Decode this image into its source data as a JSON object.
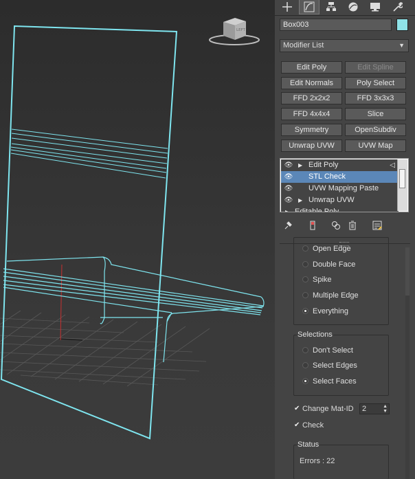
{
  "panel": {
    "tabs": [
      {
        "name": "create-tab",
        "icon": "plus-icon"
      },
      {
        "name": "modify-tab",
        "icon": "modify-curve-icon"
      },
      {
        "name": "hierarchy-tab",
        "icon": "hierarchy-icon"
      },
      {
        "name": "motion-tab",
        "icon": "motion-icon"
      },
      {
        "name": "display-tab",
        "icon": "display-icon"
      },
      {
        "name": "utilities-tab",
        "icon": "wrench-icon"
      }
    ],
    "object_name": "Box003",
    "object_color": "#8fe3e8",
    "modifier_list_label": "Modifier List",
    "modifier_buttons": [
      {
        "label": "Edit Poly",
        "enabled": true
      },
      {
        "label": "Edit Spline",
        "enabled": false
      },
      {
        "label": "Edit Normals",
        "enabled": true
      },
      {
        "label": "Poly Select",
        "enabled": true
      },
      {
        "label": "FFD 2x2x2",
        "enabled": true
      },
      {
        "label": "FFD 3x3x3",
        "enabled": true
      },
      {
        "label": "FFD 4x4x4",
        "enabled": true
      },
      {
        "label": "Slice",
        "enabled": true
      },
      {
        "label": "Symmetry",
        "enabled": true
      },
      {
        "label": "OpenSubdiv",
        "enabled": true
      },
      {
        "label": "Unwrap UVW",
        "enabled": true
      },
      {
        "label": "UVW Map",
        "enabled": true
      }
    ],
    "stack": [
      {
        "label": "Edit Poly",
        "expandable": true,
        "selected": false
      },
      {
        "label": "STL Check",
        "expandable": false,
        "selected": true
      },
      {
        "label": "UVW Mapping Paste",
        "expandable": false,
        "selected": false
      },
      {
        "label": "Unwrap UVW",
        "expandable": true,
        "selected": false
      },
      {
        "label": "Editable Poly",
        "expandable": true,
        "selected": false
      }
    ],
    "check_options": [
      {
        "label": "Open Edge",
        "checked": false
      },
      {
        "label": "Double Face",
        "checked": false
      },
      {
        "label": "Spike",
        "checked": false
      },
      {
        "label": "Multiple Edge",
        "checked": false
      },
      {
        "label": "Everything",
        "checked": true
      }
    ],
    "selections": {
      "title": "Selections",
      "options": [
        {
          "label": "Don't Select",
          "checked": false
        },
        {
          "label": "Select Edges",
          "checked": false
        },
        {
          "label": "Select Faces",
          "checked": true
        }
      ]
    },
    "change_mat_id": {
      "label": "Change Mat-ID",
      "checked": true,
      "value": "2"
    },
    "check": {
      "label": "Check",
      "checked": true
    },
    "status": {
      "title": "Status",
      "text": "Errors : 22"
    }
  },
  "colors": {
    "wire": "#7fe6f0",
    "grid": "#5c5c5c",
    "axis_red": "#c83030",
    "selection_blue": "#5b87b8"
  }
}
